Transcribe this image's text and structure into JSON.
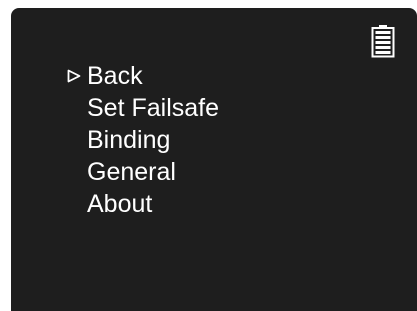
{
  "status_bar": {
    "battery_icon": "battery-full-icon"
  },
  "menu": {
    "selected_index": 0,
    "items": [
      {
        "label": "Back"
      },
      {
        "label": "Set Failsafe"
      },
      {
        "label": "Binding"
      },
      {
        "label": "General"
      },
      {
        "label": "About"
      }
    ]
  },
  "colors": {
    "background": "#1e1e1e",
    "text": "#ffffff"
  }
}
